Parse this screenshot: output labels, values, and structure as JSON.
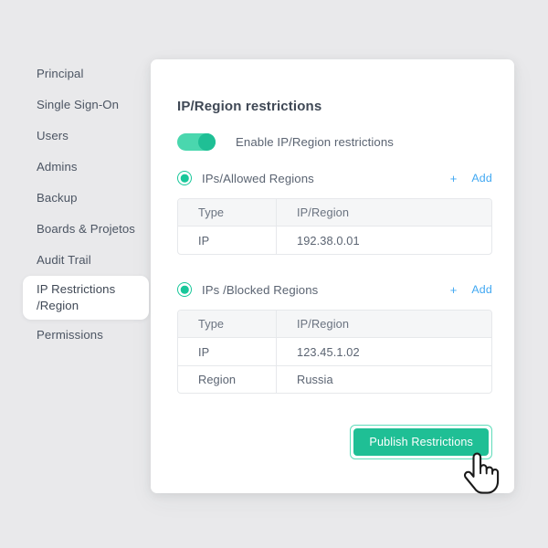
{
  "sidebar": {
    "items": [
      {
        "label": "Principal",
        "active": false
      },
      {
        "label": "Single Sign-On",
        "active": false
      },
      {
        "label": "Users",
        "active": false
      },
      {
        "label": "Admins",
        "active": false
      },
      {
        "label": "Backup",
        "active": false
      },
      {
        "label": "Boards & Projetos",
        "active": false
      },
      {
        "label": "Audit Trail",
        "active": false
      },
      {
        "label": "IP Restrictions\n/Region",
        "active": true
      },
      {
        "label": "Permissions",
        "active": false
      }
    ]
  },
  "card": {
    "title": "IP/Region restrictions",
    "toggle": {
      "label": "Enable IP/Region restrictions",
      "state": "on"
    },
    "sections": [
      {
        "radio_label": "IPs/Allowed Regions",
        "radio_state": "selected",
        "add_plus": "+",
        "add_label": "Add",
        "table": {
          "headers": [
            "Type",
            "IP/Region"
          ],
          "rows": [
            [
              "IP",
              "192.38.0.01"
            ]
          ]
        }
      },
      {
        "radio_label": "IPs /Blocked Regions",
        "radio_state": "selected",
        "add_plus": "+",
        "add_label": "Add",
        "table": {
          "headers": [
            "Type",
            "IP/Region"
          ],
          "rows": [
            [
              "IP",
              "123.45.1.02"
            ],
            [
              "Region",
              "Russia"
            ]
          ]
        }
      }
    ],
    "publish_button": {
      "label": "Publish Restrictions",
      "focused": true
    }
  },
  "cursor": {
    "type": "pointing-hand"
  },
  "colors": {
    "page_background": "#e9e9eb",
    "card_background": "#ffffff",
    "accent_green": "#1fbf95",
    "toggle_track_green": "#4ad7ae",
    "radio_green": "#18c79a",
    "link_blue": "#3fa7f2",
    "text_primary": "#3f4855",
    "text_secondary": "#5b6472",
    "table_header_background": "#f5f6f7",
    "table_border": "#e6e8eb",
    "focus_ring_green": "#5fdcba"
  }
}
